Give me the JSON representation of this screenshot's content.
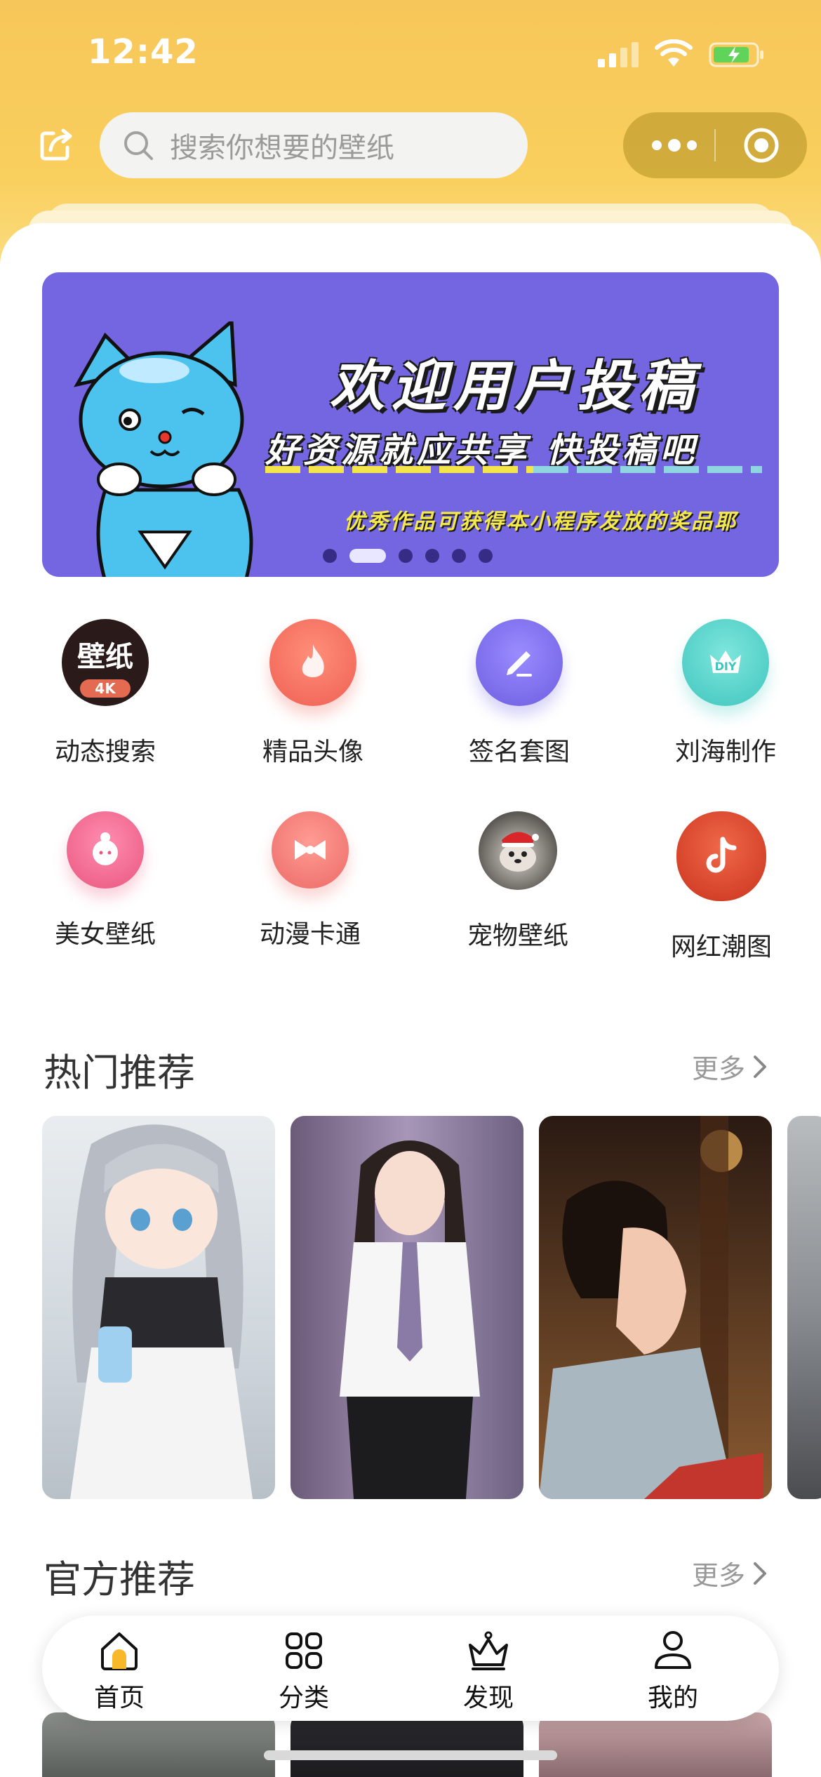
{
  "status": {
    "time": "12:42"
  },
  "search": {
    "placeholder": "搜索你想要的壁纸"
  },
  "banner": {
    "title": "欢迎用户投稿",
    "subtitle": "好资源就应共享  快投稿吧",
    "note": "优秀作品可获得本小程序发放的奖品耶",
    "badge_text": "4K",
    "slide_count": 6,
    "active_slide": 2
  },
  "categories": [
    {
      "label": "动态搜索",
      "icon": "wallpaper-4k-icon",
      "icon_text": "壁纸",
      "color": "#2a1a1a"
    },
    {
      "label": "精品头像",
      "icon": "flame-icon",
      "color": "#ef6a5c"
    },
    {
      "label": "签名套图",
      "icon": "pen-icon",
      "color": "#7c6ce8"
    },
    {
      "label": "刘海制作",
      "icon": "crown-diy-icon",
      "icon_text": "DIY",
      "color": "#4fd0c8"
    },
    {
      "label": "美女壁纸",
      "icon": "girl-face-icon",
      "color": "#f0678f"
    },
    {
      "label": "动漫卡通",
      "icon": "bow-icon",
      "color": "#f07a76"
    },
    {
      "label": "宠物壁纸",
      "icon": "pet-dog-icon",
      "color": "#6b6b6b"
    },
    {
      "label": "网红潮图",
      "icon": "tiktok-icon",
      "color": "#e44a2e"
    }
  ],
  "sections": {
    "hot": {
      "title": "热门推荐",
      "more": "更多"
    },
    "official": {
      "title": "官方推荐",
      "more": "更多"
    }
  },
  "hot_items": [
    {
      "name": "anime-girl-wallpaper",
      "colors": [
        "#e8ecef",
        "#9aa6b0"
      ]
    },
    {
      "name": "school-uniform-girl-wallpaper",
      "colors": [
        "#7a6a8a",
        "#c8b8d8"
      ]
    },
    {
      "name": "ancient-costume-wallpaper",
      "colors": [
        "#3a2418",
        "#c0884a"
      ]
    },
    {
      "name": "city-wallpaper",
      "colors": [
        "#9aa0a4",
        "#5c6064"
      ]
    }
  ],
  "tabs": [
    {
      "label": "首页",
      "icon": "home-icon",
      "active": true
    },
    {
      "label": "分类",
      "icon": "grid-icon"
    },
    {
      "label": "发现",
      "icon": "crown-icon"
    },
    {
      "label": "我的",
      "icon": "user-icon"
    }
  ]
}
